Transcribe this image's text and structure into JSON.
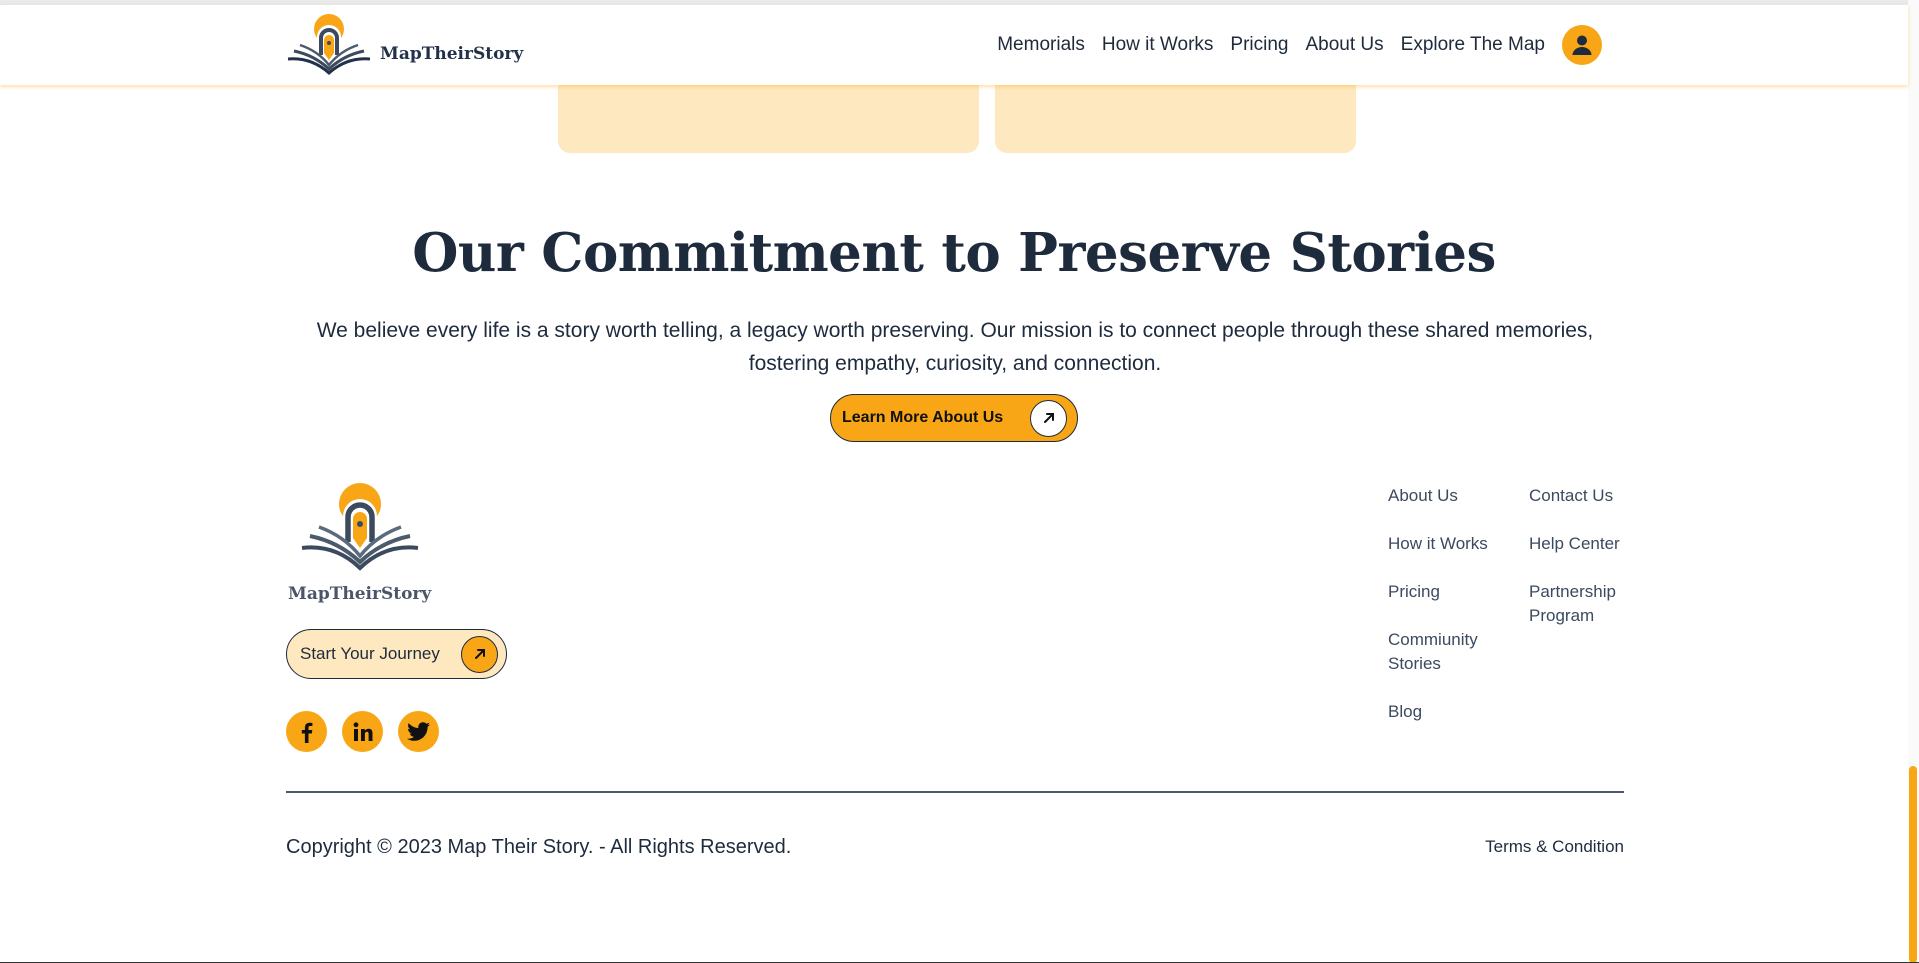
{
  "header": {
    "brand": "MapTheirStory",
    "nav": [
      "Memorials",
      "How it Works",
      "Pricing",
      "About Us",
      "Explore The Map"
    ],
    "profile_icon": "user-icon"
  },
  "commitment": {
    "title": "Our Commitment to Preserve Stories",
    "description": "We believe every life is a story worth telling, a legacy worth preserving. Our mission is to connect people through these shared memories, fostering empathy, curiosity, and connection.",
    "button_label": "Learn More About Us",
    "button_icon": "arrow-up-right-icon"
  },
  "footer": {
    "brand": "MapTheirStory",
    "journey_button": "Start Your Journey",
    "socials": [
      "facebook-icon",
      "linkedin-icon",
      "twitter-icon"
    ],
    "links_col1": [
      "About Us",
      "How it Works",
      "Pricing",
      "Commiunity Stories",
      "Blog"
    ],
    "links_col2": [
      "Contact Us",
      "Help Center",
      "Partnership Program"
    ],
    "copyright": "Copyright © 2023 Map Their Story. - All Rights Reserved.",
    "terms": "Terms & Condition"
  },
  "colors": {
    "accent": "#F8A616",
    "accent_light": "#FEE8BF",
    "navy": "#1E2B3D"
  }
}
